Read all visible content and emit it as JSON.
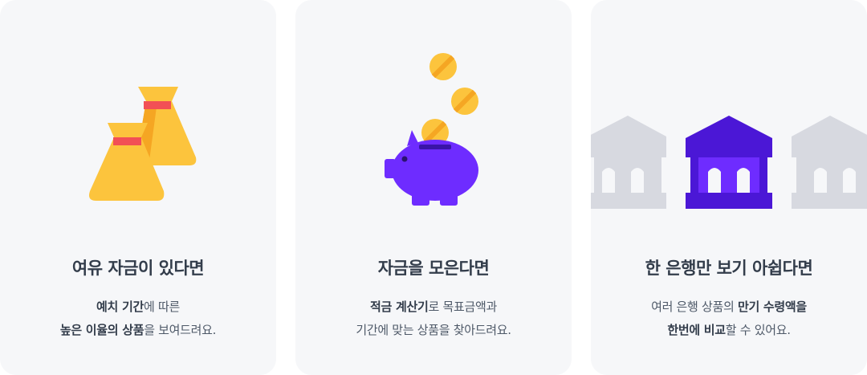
{
  "cards": [
    {
      "title": "여유 자금이 있다면",
      "line1": [
        {
          "text": "예치 기간",
          "bold": true
        },
        {
          "text": "에 따른",
          "bold": false
        }
      ],
      "line2": [
        {
          "text": "높은 이율의 상품",
          "bold": true
        },
        {
          "text": "을 보여드려요.",
          "bold": false
        }
      ],
      "icon": "money-bag-icon"
    },
    {
      "title": "자금을 모은다면",
      "line1": [
        {
          "text": "적금 계산기",
          "bold": true
        },
        {
          "text": "로 목표금액과",
          "bold": false
        }
      ],
      "line2": [
        {
          "text": "기간에 맞는 상품을 찾아드려요.",
          "bold": false
        }
      ],
      "icon": "piggy-bank-icon"
    },
    {
      "title": "한 은행만 보기 아쉽다면",
      "line1": [
        {
          "text": "여러 은행 상품의 ",
          "bold": false
        },
        {
          "text": "만기 수령액을",
          "bold": true
        }
      ],
      "line2": [
        {
          "text": "한번에 비교",
          "bold": true
        },
        {
          "text": "할 수 있어요.",
          "bold": false
        }
      ],
      "icon": "bank-icon"
    }
  ],
  "colors": {
    "card_bg": "#f6f7f9",
    "bag_yellow": "#fcc43d",
    "bag_dark": "#f5a623",
    "tie_red": "#f25055",
    "piggy_purple": "#6e2cff",
    "bank_purple": "#4b17d6",
    "bank_gray": "#d7d9e0"
  }
}
